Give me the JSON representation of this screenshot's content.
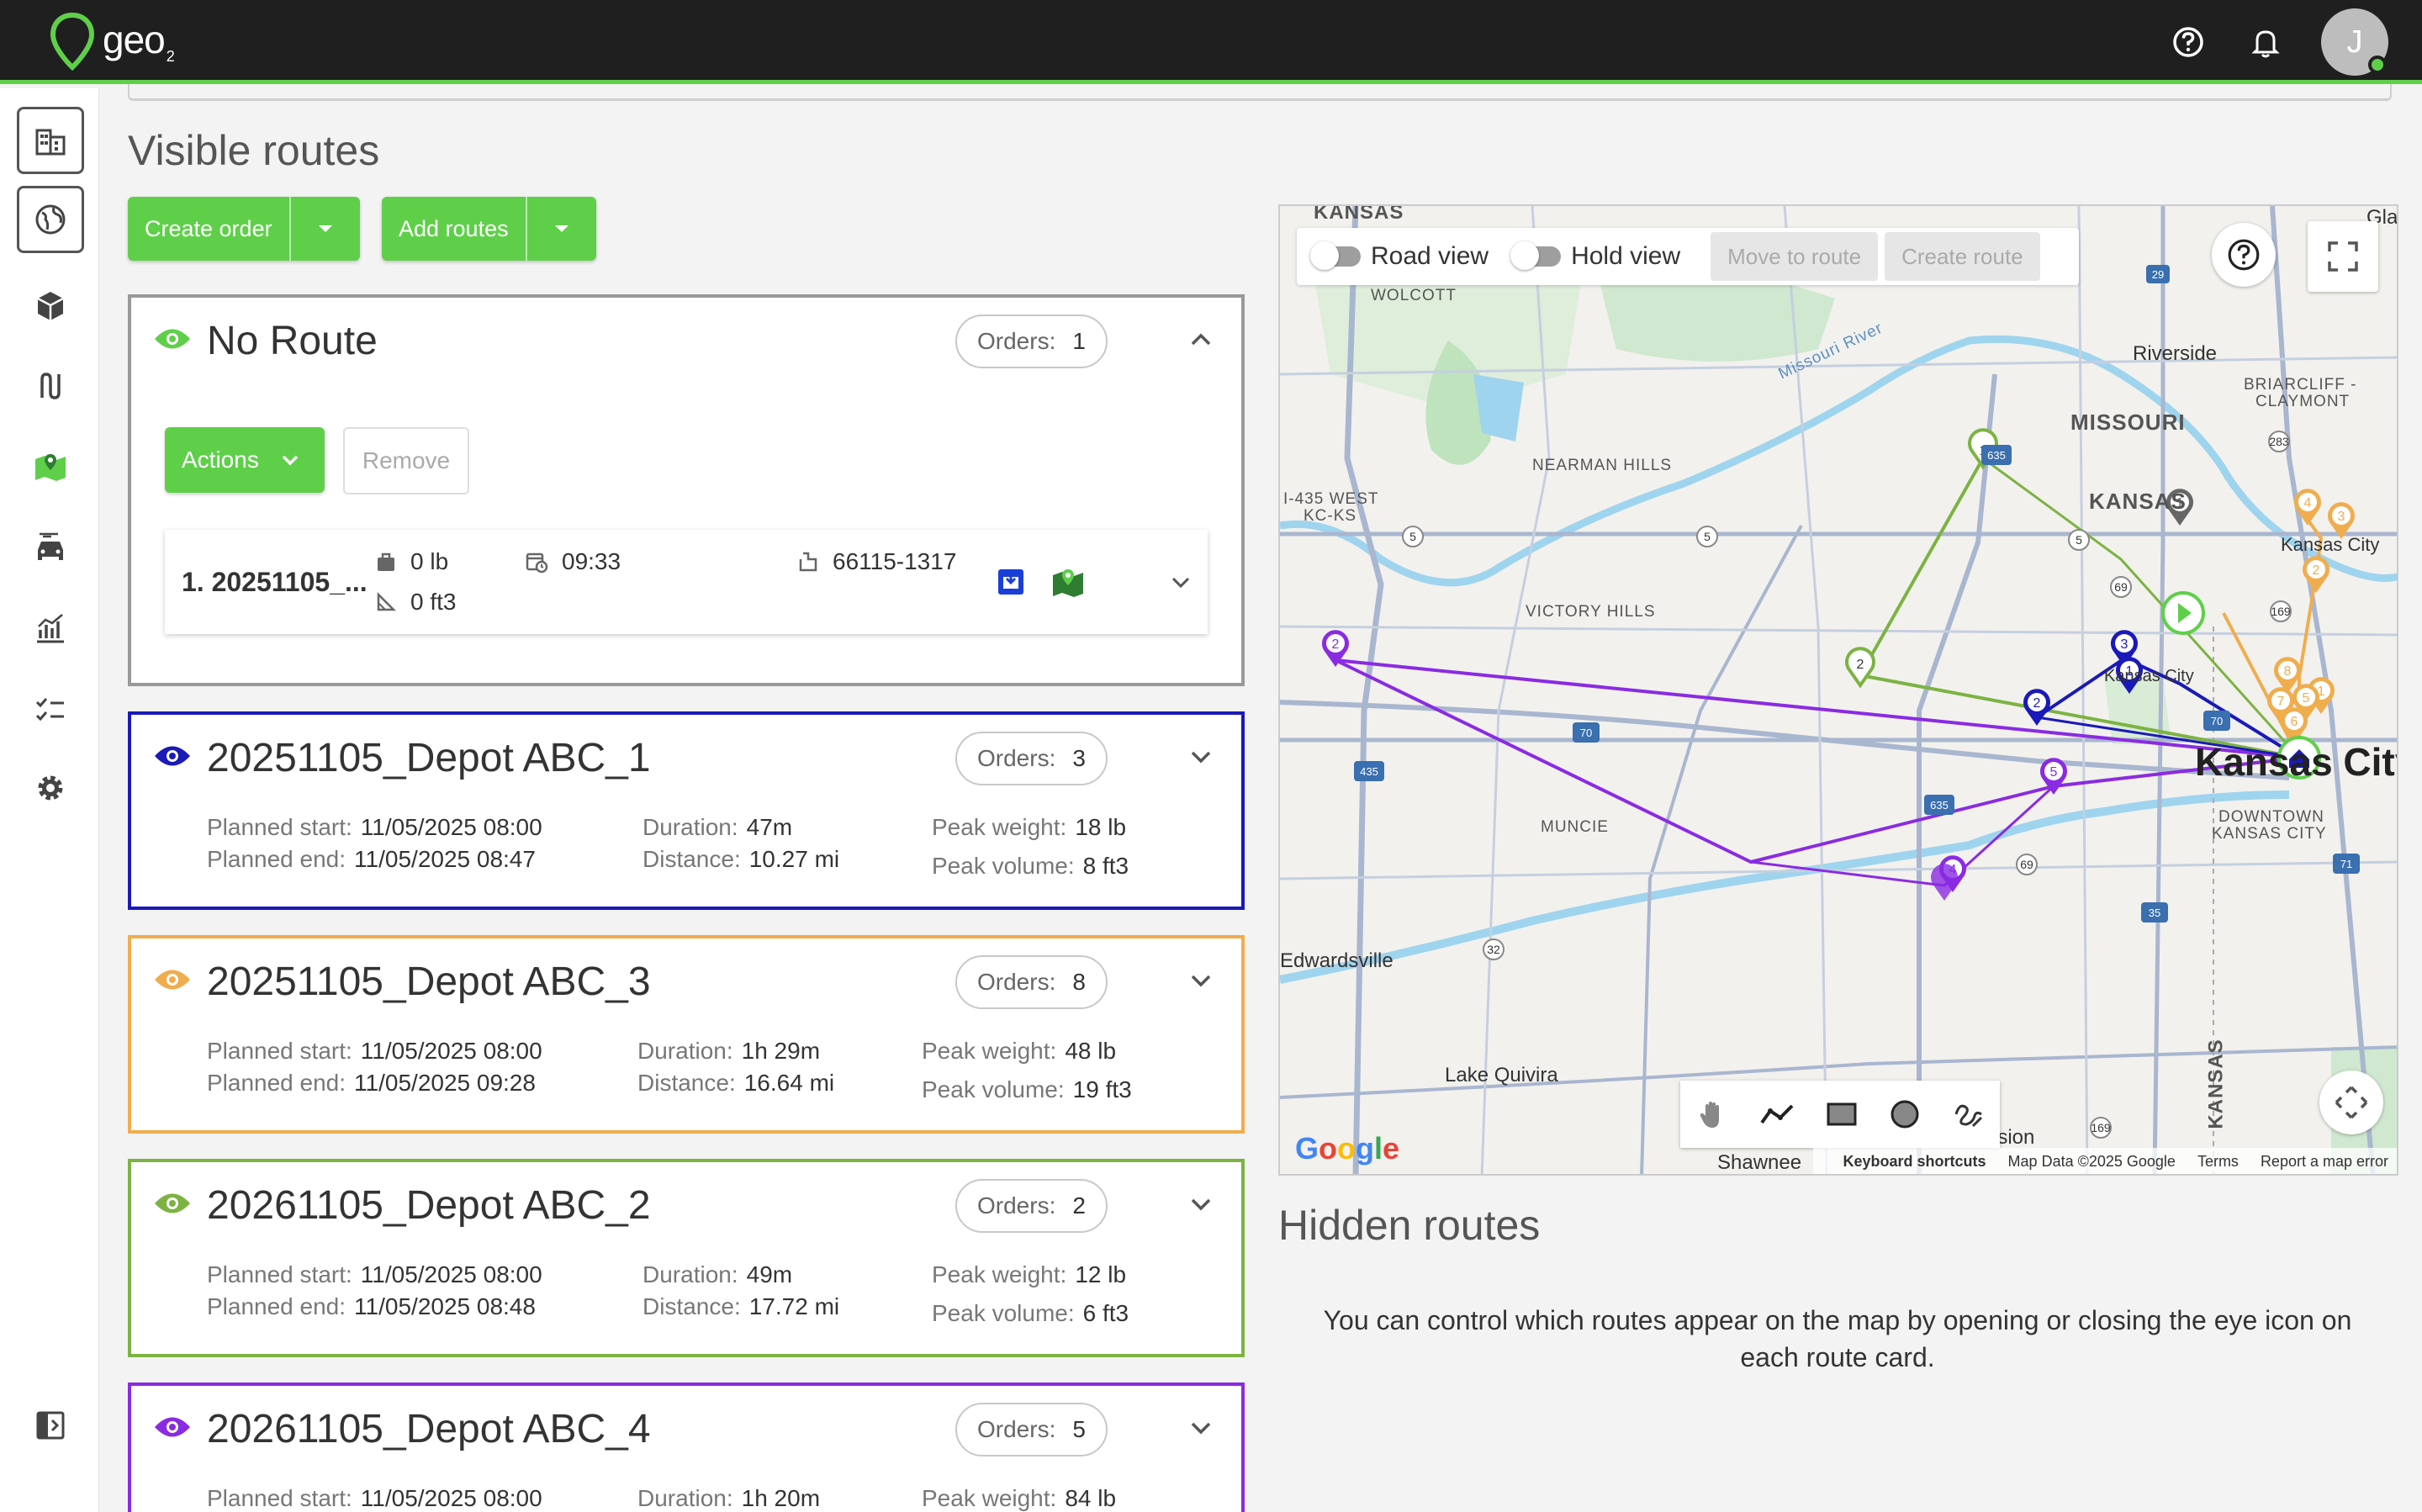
{
  "app": {
    "logo_text": "geo",
    "logo_sub": "2",
    "avatar_initial": "J"
  },
  "colors": {
    "accent": "#5fcf4a",
    "route_blue": "#1a1ab8",
    "route_orange": "#f0ad4e",
    "route_green": "#7cb342",
    "route_purple": "#8a2be2",
    "no_route": "#999999"
  },
  "sidebar": {
    "items": [
      {
        "icon": "building-icon"
      },
      {
        "icon": "globe-icon"
      },
      {
        "icon": "package-icon"
      },
      {
        "icon": "route-icon"
      },
      {
        "icon": "map-icon"
      },
      {
        "icon": "car-icon"
      },
      {
        "icon": "analytics-icon"
      },
      {
        "icon": "checklist-icon"
      },
      {
        "icon": "settings-icon"
      },
      {
        "icon": "collapse-sidebar-icon"
      }
    ]
  },
  "main": {
    "title": "Visible routes",
    "create_order_label": "Create order",
    "add_routes_label": "Add routes"
  },
  "no_route": {
    "title": "No Route",
    "orders_label": "Orders:",
    "orders_count": "1",
    "actions_label": "Actions",
    "remove_label": "Remove",
    "order": {
      "name": "1. 20251105_...",
      "weight": "0 lb",
      "volume": "0 ft3",
      "time": "09:33",
      "zip": "66115-1317"
    }
  },
  "labels": {
    "planned_start": "Planned start:",
    "planned_end": "Planned end:",
    "duration": "Duration:",
    "distance": "Distance:",
    "peak_weight": "Peak weight:",
    "peak_volume": "Peak volume:"
  },
  "routes": [
    {
      "title": "20251105_Depot ABC_1",
      "orders": "3",
      "start": "11/05/2025 08:00",
      "end": "11/05/2025 08:47",
      "duration": "47m",
      "distance": "10.27 mi",
      "weight": "18 lb",
      "volume": "8 ft3",
      "color": "#1a1ab8"
    },
    {
      "title": "20251105_Depot ABC_3",
      "orders": "8",
      "start": "11/05/2025 08:00",
      "end": "11/05/2025 09:28",
      "duration": "1h 29m",
      "distance": "16.64 mi",
      "weight": "48 lb",
      "volume": "19 ft3",
      "color": "#f0ad4e"
    },
    {
      "title": "20261105_Depot ABC_2",
      "orders": "2",
      "start": "11/05/2025 08:00",
      "end": "11/05/2025 08:48",
      "duration": "49m",
      "distance": "17.72 mi",
      "weight": "12 lb",
      "volume": "6 ft3",
      "color": "#7cb342"
    },
    {
      "title": "20261105_Depot ABC_4",
      "orders": "5",
      "start": "11/05/2025 08:00",
      "end": "",
      "duration": "1h 20m",
      "distance": "",
      "weight": "84 lb",
      "volume": "",
      "color": "#8a2be2"
    }
  ],
  "map": {
    "road_view": "Road view",
    "hold_view": "Hold view",
    "move_to_route": "Move to route",
    "create_route": "Create route",
    "places": {
      "wolcott": "WOLCOTT",
      "nearman": "NEARMAN HILLS",
      "i435west": "I-435 WEST",
      "kcks": "KC-KS",
      "victory": "VICTORY HILLS",
      "muncie": "MUNCIE",
      "edwardsville": "Edwardsville",
      "lake_quivira": "Lake Quivira",
      "shawnee": "Shawnee",
      "mission": "Mission",
      "riverside": "Riverside",
      "briarcliff": "BRIARCLIFF -",
      "claymont": "CLAYMONT",
      "missouri": "MISSOURI",
      "kansas": "KANSAS",
      "kansas_city_small": "Kansas City",
      "kansas_city_big": "Kansas City",
      "downtown": "DOWNTOWN",
      "downtown2": "KANSAS CITY",
      "missouri_river": "Missouri River",
      "kansas_vertical": "KANSAS",
      "kansas_top": "KANSAS",
      "glad": "Glad"
    },
    "google": "Google",
    "footer": {
      "shortcuts": "Keyboard shortcuts",
      "data": "Map Data ©2025 Google",
      "terms": "Terms",
      "report": "Report a map error"
    }
  },
  "hidden": {
    "title": "Hidden routes",
    "message": "You can control which routes appear on the map by opening or closing the eye icon on each route card."
  }
}
